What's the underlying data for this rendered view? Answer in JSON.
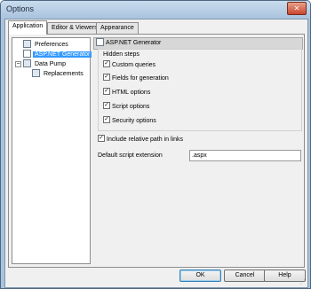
{
  "window": {
    "title": "Options",
    "close_glyph": "✕"
  },
  "tabs": [
    {
      "label": "Application",
      "active": true
    },
    {
      "label": "Editor & Viewers",
      "active": false
    },
    {
      "label": "Appearance",
      "active": false
    }
  ],
  "tree": {
    "items": [
      {
        "label": "Preferences",
        "icon": "preferences-icon"
      },
      {
        "label": "ASP.NET Generator",
        "icon": "asp-generator-icon",
        "selected": true
      },
      {
        "label": "Data Pump",
        "icon": "data-pump-icon",
        "expander": "−"
      },
      {
        "label": "Replacements",
        "icon": "replacements-icon"
      }
    ]
  },
  "panel": {
    "header": "ASP.NET Generator",
    "group_label": "Hidden steps",
    "hidden_steps": [
      {
        "label": "Custom queries",
        "checked": true
      },
      {
        "label": "Fields for generation",
        "checked": true
      },
      {
        "label": "HTML options",
        "checked": true
      },
      {
        "label": "Script options",
        "checked": true
      },
      {
        "label": "Security options",
        "checked": true
      }
    ],
    "include_relative_path": {
      "label": "Include relative path in links",
      "checked": true
    },
    "script_extension": {
      "label": "Default script extension",
      "value": ".aspx"
    },
    "check_glyph": "✓"
  },
  "buttons": {
    "ok": "OK",
    "cancel": "Cancel",
    "help": "Help"
  }
}
